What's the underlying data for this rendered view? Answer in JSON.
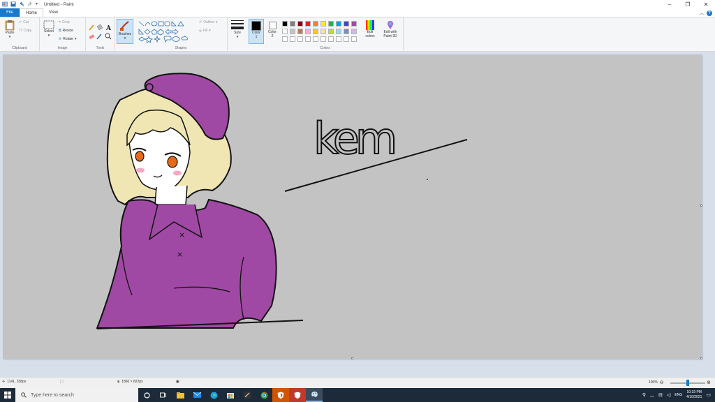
{
  "window": {
    "title": "Untitled - Paint"
  },
  "tabs": [
    {
      "label": "File"
    },
    {
      "label": "Home"
    },
    {
      "label": "View"
    }
  ],
  "ribbon": {
    "clipboard": {
      "label": "Clipboard",
      "paste": "Paste",
      "cut": "Cut",
      "copy": "Copy"
    },
    "image": {
      "label": "Image",
      "select": "Select",
      "crop": "Crop",
      "resize": "Resize",
      "rotate": "Rotate"
    },
    "tools": {
      "label": "Tools"
    },
    "brushes": {
      "label": "Brushes"
    },
    "shapes": {
      "label": "Shapes",
      "outline": "Outline",
      "fill": "Fill"
    },
    "size": {
      "label": "Size"
    },
    "colors": {
      "label": "Colors",
      "color1": "Color 1",
      "color2": "Color 2",
      "edit_colors": "Edit colors",
      "edit_paint3d": "Edit with Paint 3D",
      "row1": [
        "#000000",
        "#7f7f7f",
        "#880015",
        "#ed1c24",
        "#ff7f27",
        "#fff200",
        "#22b14c",
        "#00a2e8",
        "#3f48cc",
        "#a349a4"
      ],
      "row2": [
        "#ffffff",
        "#c3c3c3",
        "#b97a57",
        "#ffaec9",
        "#ffc90e",
        "#efe4b0",
        "#b5e61d",
        "#99d9ea",
        "#7092be",
        "#c8bfe7"
      ]
    }
  },
  "canvas": {
    "background": "#c3c3c3",
    "drawing": {
      "signature_text": "kem"
    }
  },
  "status": {
    "cursor_pos": "1141, 338px",
    "canvas_size": "1860 × 822px",
    "zoom": "100%"
  },
  "taskbar": {
    "search_placeholder": "Type here to search",
    "language": "ENG",
    "time": "10:19 PM",
    "date": "4/10/2021"
  }
}
